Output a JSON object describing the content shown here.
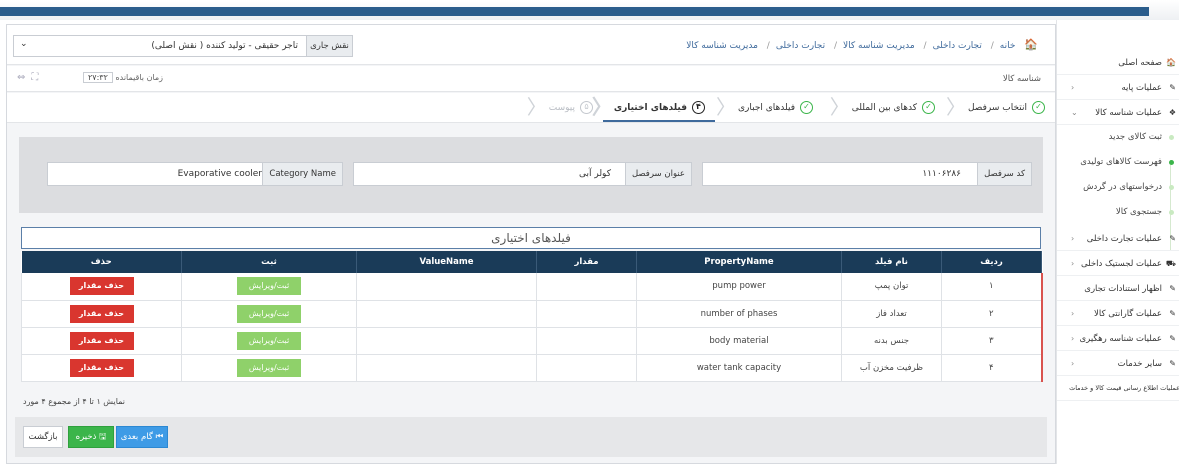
{
  "header": {
    "breadcrumb": [
      "خانه",
      "تجارت داخلی",
      "مدیریت شناسه کالا",
      "تجارت داخلی",
      "مدیریت شناسه کالا"
    ],
    "role_label": "نقش جاری",
    "role_value": "تاجر حقیقی - تولید کننده ( نقش اصلی)"
  },
  "subheader": {
    "title": "شناسه کالا",
    "timer_label": "زمان باقیمانده",
    "timer_value": "۲۷:۳۲"
  },
  "steps": [
    {
      "num": "✓",
      "label": "انتخاب سرفصل",
      "state": "done"
    },
    {
      "num": "✓",
      "label": "کدهای بین المللی",
      "state": "done"
    },
    {
      "num": "✓",
      "label": "فیلدهای اجباری",
      "state": "done"
    },
    {
      "num": "۴",
      "label": "فیلدهای اختیاری",
      "state": "active"
    },
    {
      "num": "۵",
      "label": "پیوست",
      "state": "disabled"
    }
  ],
  "info": {
    "code_label": "کد سرفصل",
    "code_value": "۱۱۱۰۶۲۸۶",
    "title_label": "عنوان سرفصل",
    "title_value": "کولر آبی",
    "category_label": "Category Name",
    "category_value": "Evaporative cooler"
  },
  "section_title": "فیلدهای اختیاری",
  "table": {
    "headers": [
      "ردیف",
      "نام فیلد",
      "PropertyName",
      "مقدار",
      "ValueName",
      "ثبت",
      "حذف"
    ],
    "rows": [
      {
        "idx": "۱",
        "name": "توان پمپ",
        "property": "pump power",
        "value": "",
        "value_name": "",
        "edit": "ثبت/ویرایش",
        "delete": "حذف مقدار"
      },
      {
        "idx": "۲",
        "name": "تعداد فاز",
        "property": "number of phases",
        "value": "",
        "value_name": "",
        "edit": "ثبت/ویرایش",
        "delete": "حذف مقدار"
      },
      {
        "idx": "۳",
        "name": "جنس بدنه",
        "property": "body material",
        "value": "",
        "value_name": "",
        "edit": "ثبت/ویرایش",
        "delete": "حذف مقدار"
      },
      {
        "idx": "۴",
        "name": "ظرفیت مخزن آب",
        "property": "water tank capacity",
        "value": "",
        "value_name": "",
        "edit": "ثبت/ویرایش",
        "delete": "حذف مقدار"
      }
    ]
  },
  "paging": "نمایش ۱ تا ۴ از مجموع ۴ مورد",
  "footer": {
    "back": "بازگشت",
    "save": "ذخیره",
    "next": "گام بعدی"
  },
  "sidebar": {
    "items": [
      {
        "label": "صفحه اصلی",
        "icon": "home-icon",
        "glyph": "🏠"
      },
      {
        "label": "عملیات پایه",
        "icon": "edit-icon",
        "glyph": "✎"
      },
      {
        "label": "عملیات شناسه کالا",
        "icon": "cubes-icon",
        "glyph": "❖"
      }
    ],
    "sub": [
      "ثبت کالای جدید",
      "فهرست کالاهای تولیدی",
      "درخواستهای در گردش",
      "جستجوی کالا"
    ],
    "items2": [
      {
        "label": "عملیات تجارت داخلی",
        "icon": "edit-icon",
        "glyph": "✎"
      },
      {
        "label": "عملیات لجستیک داخلی",
        "icon": "truck-icon",
        "glyph": "⛟"
      },
      {
        "label": "اظهار استنادات تجاری",
        "icon": "edit-icon",
        "glyph": "✎"
      },
      {
        "label": "عملیات گارانتی کالا",
        "icon": "edit-icon",
        "glyph": "✎"
      },
      {
        "label": "عملیات شناسه رهگیری",
        "icon": "edit-icon",
        "glyph": "✎"
      },
      {
        "label": "سایر خدمات",
        "icon": "edit-icon",
        "glyph": "✎"
      },
      {
        "label": "عملیات اطلاع رسانی قیمت کالا و خدمات",
        "icon": "edit-icon",
        "glyph": ""
      }
    ]
  }
}
